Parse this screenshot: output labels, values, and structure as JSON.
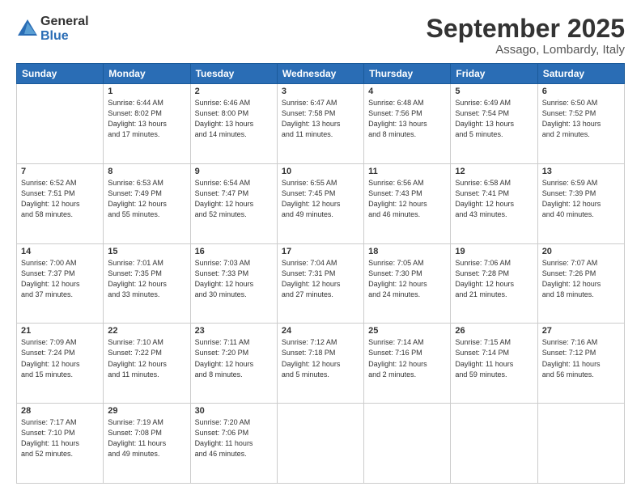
{
  "logo": {
    "general": "General",
    "blue": "Blue"
  },
  "title": "September 2025",
  "location": "Assago, Lombardy, Italy",
  "days_header": [
    "Sunday",
    "Monday",
    "Tuesday",
    "Wednesday",
    "Thursday",
    "Friday",
    "Saturday"
  ],
  "weeks": [
    [
      {
        "day": "",
        "info": ""
      },
      {
        "day": "1",
        "info": "Sunrise: 6:44 AM\nSunset: 8:02 PM\nDaylight: 13 hours\nand 17 minutes."
      },
      {
        "day": "2",
        "info": "Sunrise: 6:46 AM\nSunset: 8:00 PM\nDaylight: 13 hours\nand 14 minutes."
      },
      {
        "day": "3",
        "info": "Sunrise: 6:47 AM\nSunset: 7:58 PM\nDaylight: 13 hours\nand 11 minutes."
      },
      {
        "day": "4",
        "info": "Sunrise: 6:48 AM\nSunset: 7:56 PM\nDaylight: 13 hours\nand 8 minutes."
      },
      {
        "day": "5",
        "info": "Sunrise: 6:49 AM\nSunset: 7:54 PM\nDaylight: 13 hours\nand 5 minutes."
      },
      {
        "day": "6",
        "info": "Sunrise: 6:50 AM\nSunset: 7:52 PM\nDaylight: 13 hours\nand 2 minutes."
      }
    ],
    [
      {
        "day": "7",
        "info": "Sunrise: 6:52 AM\nSunset: 7:51 PM\nDaylight: 12 hours\nand 58 minutes."
      },
      {
        "day": "8",
        "info": "Sunrise: 6:53 AM\nSunset: 7:49 PM\nDaylight: 12 hours\nand 55 minutes."
      },
      {
        "day": "9",
        "info": "Sunrise: 6:54 AM\nSunset: 7:47 PM\nDaylight: 12 hours\nand 52 minutes."
      },
      {
        "day": "10",
        "info": "Sunrise: 6:55 AM\nSunset: 7:45 PM\nDaylight: 12 hours\nand 49 minutes."
      },
      {
        "day": "11",
        "info": "Sunrise: 6:56 AM\nSunset: 7:43 PM\nDaylight: 12 hours\nand 46 minutes."
      },
      {
        "day": "12",
        "info": "Sunrise: 6:58 AM\nSunset: 7:41 PM\nDaylight: 12 hours\nand 43 minutes."
      },
      {
        "day": "13",
        "info": "Sunrise: 6:59 AM\nSunset: 7:39 PM\nDaylight: 12 hours\nand 40 minutes."
      }
    ],
    [
      {
        "day": "14",
        "info": "Sunrise: 7:00 AM\nSunset: 7:37 PM\nDaylight: 12 hours\nand 37 minutes."
      },
      {
        "day": "15",
        "info": "Sunrise: 7:01 AM\nSunset: 7:35 PM\nDaylight: 12 hours\nand 33 minutes."
      },
      {
        "day": "16",
        "info": "Sunrise: 7:03 AM\nSunset: 7:33 PM\nDaylight: 12 hours\nand 30 minutes."
      },
      {
        "day": "17",
        "info": "Sunrise: 7:04 AM\nSunset: 7:31 PM\nDaylight: 12 hours\nand 27 minutes."
      },
      {
        "day": "18",
        "info": "Sunrise: 7:05 AM\nSunset: 7:30 PM\nDaylight: 12 hours\nand 24 minutes."
      },
      {
        "day": "19",
        "info": "Sunrise: 7:06 AM\nSunset: 7:28 PM\nDaylight: 12 hours\nand 21 minutes."
      },
      {
        "day": "20",
        "info": "Sunrise: 7:07 AM\nSunset: 7:26 PM\nDaylight: 12 hours\nand 18 minutes."
      }
    ],
    [
      {
        "day": "21",
        "info": "Sunrise: 7:09 AM\nSunset: 7:24 PM\nDaylight: 12 hours\nand 15 minutes."
      },
      {
        "day": "22",
        "info": "Sunrise: 7:10 AM\nSunset: 7:22 PM\nDaylight: 12 hours\nand 11 minutes."
      },
      {
        "day": "23",
        "info": "Sunrise: 7:11 AM\nSunset: 7:20 PM\nDaylight: 12 hours\nand 8 minutes."
      },
      {
        "day": "24",
        "info": "Sunrise: 7:12 AM\nSunset: 7:18 PM\nDaylight: 12 hours\nand 5 minutes."
      },
      {
        "day": "25",
        "info": "Sunrise: 7:14 AM\nSunset: 7:16 PM\nDaylight: 12 hours\nand 2 minutes."
      },
      {
        "day": "26",
        "info": "Sunrise: 7:15 AM\nSunset: 7:14 PM\nDaylight: 11 hours\nand 59 minutes."
      },
      {
        "day": "27",
        "info": "Sunrise: 7:16 AM\nSunset: 7:12 PM\nDaylight: 11 hours\nand 56 minutes."
      }
    ],
    [
      {
        "day": "28",
        "info": "Sunrise: 7:17 AM\nSunset: 7:10 PM\nDaylight: 11 hours\nand 52 minutes."
      },
      {
        "day": "29",
        "info": "Sunrise: 7:19 AM\nSunset: 7:08 PM\nDaylight: 11 hours\nand 49 minutes."
      },
      {
        "day": "30",
        "info": "Sunrise: 7:20 AM\nSunset: 7:06 PM\nDaylight: 11 hours\nand 46 minutes."
      },
      {
        "day": "",
        "info": ""
      },
      {
        "day": "",
        "info": ""
      },
      {
        "day": "",
        "info": ""
      },
      {
        "day": "",
        "info": ""
      }
    ]
  ]
}
